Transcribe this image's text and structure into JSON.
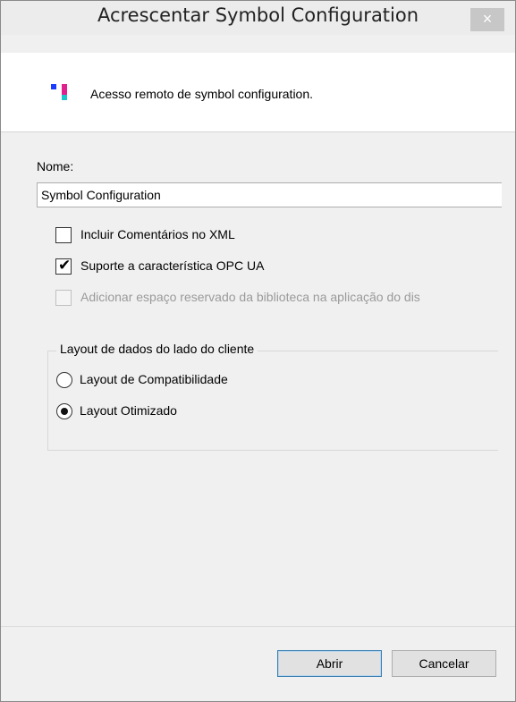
{
  "window": {
    "title": "Acrescentar Symbol Configuration",
    "close_glyph": "×"
  },
  "header": {
    "icon": "symbol-configuration-icon",
    "text": "Acesso remoto de symbol configuration."
  },
  "form": {
    "name_label": "Nome:",
    "name_value": "Symbol Configuration",
    "checkboxes": [
      {
        "label": "Incluir Comentários no XML",
        "checked": false,
        "enabled": true
      },
      {
        "label": "Suporte a característica OPC UA",
        "checked": true,
        "enabled": true
      },
      {
        "label": "Adicionar espaço reservado da biblioteca na aplicação do dis",
        "checked": false,
        "enabled": false
      }
    ],
    "group": {
      "legend": "Layout de dados do lado do cliente",
      "options": [
        {
          "label": "Layout de Compatibilidade",
          "selected": false
        },
        {
          "label": "Layout Otimizado",
          "selected": true
        }
      ]
    }
  },
  "buttons": {
    "open": "Abrir",
    "cancel": "Cancelar"
  },
  "colors": {
    "accent_border": "#3c7fb1",
    "icon_blue": "#1a3cff",
    "icon_magenta": "#e0208f",
    "icon_cyan": "#19c6c9"
  },
  "checkmark_glyph": "✔"
}
